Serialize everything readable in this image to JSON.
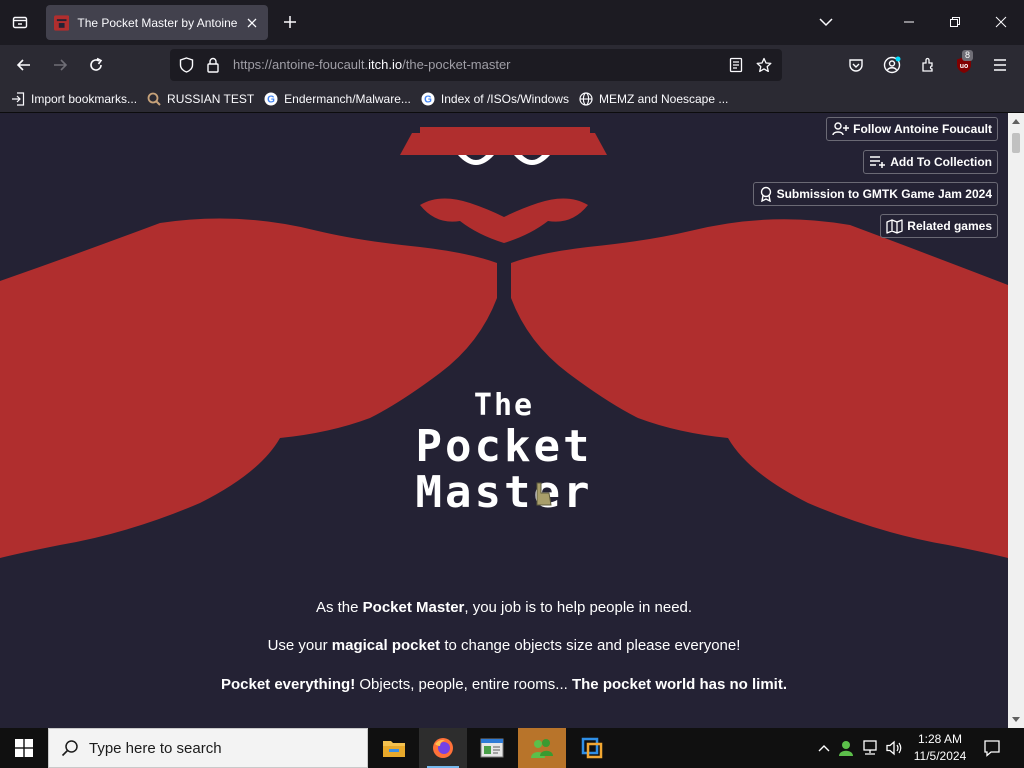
{
  "browser": {
    "tab_title": "The Pocket Master by Antoine Foucault",
    "url_prefix": "https://antoine-foucault.",
    "url_host": "itch.io",
    "url_path": "/the-pocket-master",
    "extension_badge": "8"
  },
  "bookmarks": [
    {
      "label": "Import bookmarks...",
      "icon": "import-icon"
    },
    {
      "label": "RUSSIAN TEST",
      "icon": "magnifier-icon"
    },
    {
      "label": "Endermanch/Malware...",
      "icon": "google-icon"
    },
    {
      "label": "Index of /ISOs/Windows",
      "icon": "google-icon"
    },
    {
      "label": "MEMZ and Noescape ...",
      "icon": "globe-icon"
    }
  ],
  "game_page": {
    "title_line1": "The",
    "title_line2": "Pocket",
    "title_line3": "Master",
    "buttons": {
      "follow": "Follow Antoine Foucault",
      "collection": "Add To Collection",
      "jam": "Submission to GMTK Game Jam 2024",
      "related": "Related games"
    },
    "desc1_pre": "As the ",
    "desc1_bold": "Pocket Master",
    "desc1_post": ", you job is to help people in need.",
    "desc2_pre": "Use your ",
    "desc2_bold": "magical pocket",
    "desc2_post": " to change objects size and please everyone!",
    "desc3_bold1": "Pocket everything!",
    "desc3_mid": " Objects, people, entire rooms... ",
    "desc3_bold2": "The pocket world has no limit.",
    "colors": {
      "background": "#242234",
      "red": "#b02e2e",
      "button_border": "#6b6a75"
    }
  },
  "taskbar": {
    "search_placeholder": "Type here to search",
    "time": "1:28 AM",
    "date": "11/5/2024"
  }
}
